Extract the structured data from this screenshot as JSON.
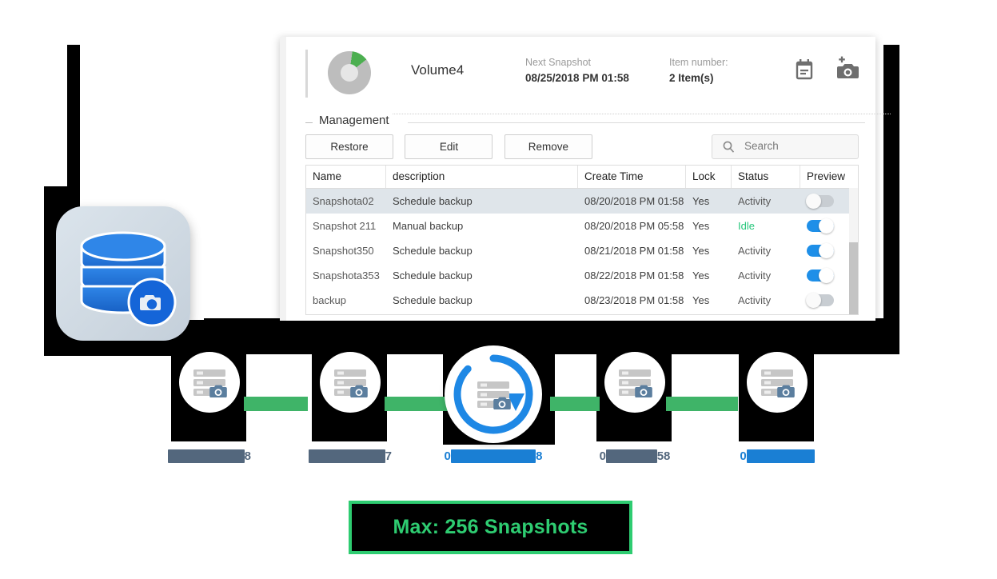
{
  "window": {
    "volume": {
      "name": "Volume4",
      "donut_used_color": "#4caf50",
      "donut_free_color": "#bdbdbd",
      "next_snapshot_label": "Next Snapshot",
      "next_snapshot_value": "08/25/2018 PM 01:58",
      "item_number_label": "Item number:",
      "item_number_value": "2 Item(s)",
      "icons": [
        {
          "name": "schedule-calendar-icon",
          "glyph": "calendar"
        },
        {
          "name": "take-snapshot-icon",
          "glyph": "camera-plus"
        }
      ]
    },
    "management": {
      "legend": "Management",
      "buttons": [
        {
          "name": "restore-button",
          "label": "Restore"
        },
        {
          "name": "edit-button",
          "label": "Edit"
        },
        {
          "name": "remove-button",
          "label": "Remove"
        }
      ],
      "search": {
        "placeholder": "Search",
        "value": "",
        "icon": "search-icon"
      },
      "table": {
        "columns": [
          "Name",
          "description",
          "Create Time",
          "Lock",
          "Status",
          "Preview"
        ],
        "rows": [
          {
            "name": "Snapshota02",
            "description": "Schedule backup",
            "create_time": "08/20/2018 PM 01:58",
            "lock": "Yes",
            "status": "Activity",
            "preview_on": false,
            "selected": true
          },
          {
            "name": "Snapshot 211",
            "description": "Manual backup",
            "create_time": "08/20/2018 PM 05:58",
            "lock": "Yes",
            "status": "Idle",
            "preview_on": true,
            "selected": false
          },
          {
            "name": "Snapshot350",
            "description": "Schedule backup",
            "create_time": "08/21/2018 PM 01:58",
            "lock": "Yes",
            "status": "Activity",
            "preview_on": true,
            "selected": false
          },
          {
            "name": "Snapshota353",
            "description": "Schedule backup",
            "create_time": "08/22/2018 PM 01:58",
            "lock": "Yes",
            "status": "Activity",
            "preview_on": true,
            "selected": false
          },
          {
            "name": "backup",
            "description": "Schedule backup",
            "create_time": "08/23/2018 PM 01:58",
            "lock": "Yes",
            "status": "Activity",
            "preview_on": false,
            "selected": false
          }
        ],
        "status_idle_color": "#24c67a",
        "selected_row_color": "#dfe5ea"
      }
    }
  },
  "app_icon": {
    "name": "database-snapshot-icon"
  },
  "timeline": {
    "connector_color": "#3fb468",
    "nodes": [
      {
        "name": "snapshot-node-1",
        "icon": "server-snapshot-icon",
        "active": false,
        "label_prefix": "",
        "label_redacted": "█████████",
        "label_suffix": "8",
        "label_color": "#53677d"
      },
      {
        "name": "snapshot-node-2",
        "icon": "server-snapshot-icon",
        "active": false,
        "label_prefix": "",
        "label_redacted": "█████████",
        "label_suffix": "7",
        "label_color": "#53677d"
      },
      {
        "name": "snapshot-node-3-restore",
        "icon": "server-snapshot-restore-icon",
        "active": true,
        "label_prefix": "0",
        "label_redacted": "██████████",
        "label_suffix": "8",
        "label_color": "#1a7fd4"
      },
      {
        "name": "snapshot-node-4",
        "icon": "server-snapshot-icon",
        "active": false,
        "label_prefix": "0",
        "label_redacted": "██████",
        "label_suffix": "58",
        "label_color": "#53677d"
      },
      {
        "name": "snapshot-node-5",
        "icon": "server-snapshot-icon",
        "active": false,
        "label_prefix": "0",
        "label_redacted": "████████",
        "label_suffix": "",
        "label_color": "#1a7fd4"
      }
    ]
  },
  "banner": {
    "text": "Max: 256 Snapshots",
    "border_color": "#2ecc71",
    "text_color": "#2ecc71",
    "background": "#000000"
  }
}
